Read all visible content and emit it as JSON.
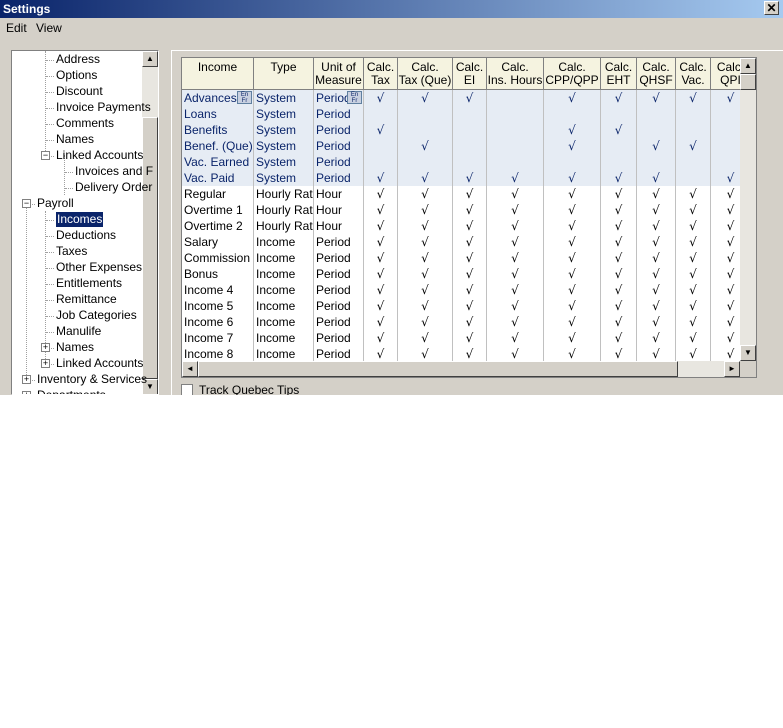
{
  "window": {
    "title": "Settings",
    "close_glyph": "✕"
  },
  "menu": {
    "items": [
      "Edit",
      "View"
    ]
  },
  "tree": {
    "items": [
      {
        "label": "Address"
      },
      {
        "label": "Options"
      },
      {
        "label": "Discount"
      },
      {
        "label": "Invoice Payments"
      },
      {
        "label": "Comments"
      },
      {
        "label": "Names"
      },
      {
        "label": "Linked Accounts",
        "expander": "−"
      },
      {
        "label": "Invoices and F"
      },
      {
        "label": "Delivery Order"
      },
      {
        "label": "Payroll",
        "expander": "−"
      },
      {
        "label": "Incomes",
        "selected": true
      },
      {
        "label": "Deductions"
      },
      {
        "label": "Taxes"
      },
      {
        "label": "Other Expenses"
      },
      {
        "label": "Entitlements"
      },
      {
        "label": "Remittance"
      },
      {
        "label": "Job Categories"
      },
      {
        "label": "Manulife"
      },
      {
        "label": "Names",
        "expander": "+"
      },
      {
        "label": "Linked Accounts",
        "expander": "+"
      },
      {
        "label": "Inventory & Services",
        "expander": "+"
      },
      {
        "label": "Departments",
        "expander": "+"
      }
    ]
  },
  "grid": {
    "columns": [
      "Income",
      "Type",
      "Unit of\nMeasure",
      "Calc.\nTax",
      "Calc.\nTax (Que)",
      "Calc.\nEI",
      "Calc.\nIns. Hours",
      "Calc.\nCPP/QPP",
      "Calc.\nEHT",
      "Calc.\nQHSF",
      "Calc.\nVac.",
      "Calc.\nQPI"
    ],
    "enfr_label": "En\nFr",
    "check_glyph": "√",
    "rows": [
      {
        "income": "Advances",
        "type": "System",
        "unit": "Period",
        "sys": true,
        "enfr": true,
        "checks": [
          1,
          1,
          1,
          0,
          1,
          1,
          1,
          1,
          1
        ]
      },
      {
        "income": "Loans",
        "type": "System",
        "unit": "Period",
        "sys": true,
        "checks": [
          0,
          0,
          0,
          0,
          0,
          0,
          0,
          0,
          0
        ]
      },
      {
        "income": "Benefits",
        "type": "System",
        "unit": "Period",
        "sys": true,
        "checks": [
          1,
          0,
          0,
          0,
          1,
          1,
          0,
          0,
          0
        ]
      },
      {
        "income": "Benef. (Que)",
        "type": "System",
        "unit": "Period",
        "sys": true,
        "checks": [
          0,
          1,
          0,
          0,
          1,
          0,
          1,
          1,
          0
        ]
      },
      {
        "income": "Vac. Earned",
        "type": "System",
        "unit": "Period",
        "sys": true,
        "checks": [
          0,
          0,
          0,
          0,
          0,
          0,
          0,
          0,
          0
        ]
      },
      {
        "income": "Vac. Paid",
        "type": "System",
        "unit": "Period",
        "sys": true,
        "checks": [
          1,
          1,
          1,
          1,
          1,
          1,
          1,
          0,
          1
        ]
      },
      {
        "income": "Regular",
        "type": "Hourly Rate",
        "unit": "Hour",
        "checks": [
          1,
          1,
          1,
          1,
          1,
          1,
          1,
          1,
          1
        ]
      },
      {
        "income": "Overtime 1",
        "type": "Hourly Rate",
        "unit": "Hour",
        "checks": [
          1,
          1,
          1,
          1,
          1,
          1,
          1,
          1,
          1
        ]
      },
      {
        "income": "Overtime 2",
        "type": "Hourly Rate",
        "unit": "Hour",
        "checks": [
          1,
          1,
          1,
          1,
          1,
          1,
          1,
          1,
          1
        ]
      },
      {
        "income": "Salary",
        "type": "Income",
        "unit": "Period",
        "checks": [
          1,
          1,
          1,
          1,
          1,
          1,
          1,
          1,
          1
        ]
      },
      {
        "income": "Commission",
        "type": "Income",
        "unit": "Period",
        "checks": [
          1,
          1,
          1,
          1,
          1,
          1,
          1,
          1,
          1
        ]
      },
      {
        "income": "Bonus",
        "type": "Income",
        "unit": "Period",
        "checks": [
          1,
          1,
          1,
          1,
          1,
          1,
          1,
          1,
          1
        ]
      },
      {
        "income": "Income 4",
        "type": "Income",
        "unit": "Period",
        "checks": [
          1,
          1,
          1,
          1,
          1,
          1,
          1,
          1,
          1
        ]
      },
      {
        "income": "Income 5",
        "type": "Income",
        "unit": "Period",
        "checks": [
          1,
          1,
          1,
          1,
          1,
          1,
          1,
          1,
          1
        ]
      },
      {
        "income": "Income 6",
        "type": "Income",
        "unit": "Period",
        "checks": [
          1,
          1,
          1,
          1,
          1,
          1,
          1,
          1,
          1
        ]
      },
      {
        "income": "Income 7",
        "type": "Income",
        "unit": "Period",
        "checks": [
          1,
          1,
          1,
          1,
          1,
          1,
          1,
          1,
          1
        ]
      },
      {
        "income": "Income 8",
        "type": "Income",
        "unit": "Period",
        "checks": [
          1,
          1,
          1,
          1,
          1,
          1,
          1,
          1,
          1
        ]
      }
    ]
  },
  "track_quebec_tips": {
    "label": "Track Quebec Tips",
    "checked": false
  },
  "icons": [
    "close-icon",
    "scroll-up-icon",
    "scroll-down-icon",
    "scroll-left-icon",
    "scroll-right-icon",
    "en-fr-icon",
    "check-icon",
    "expand-icon",
    "collapse-icon"
  ]
}
